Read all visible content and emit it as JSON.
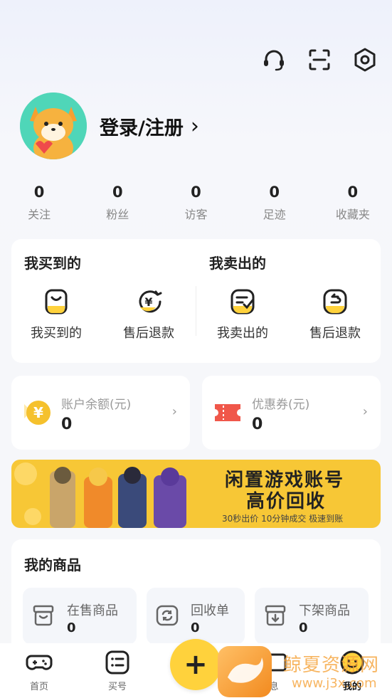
{
  "header": {
    "icons": [
      "headset-icon",
      "scan-icon",
      "settings-icon"
    ]
  },
  "profile": {
    "login_label": "登录/注册",
    "chevron": "›"
  },
  "stats": [
    {
      "value": "0",
      "label": "关注"
    },
    {
      "value": "0",
      "label": "粉丝"
    },
    {
      "value": "0",
      "label": "访客"
    },
    {
      "value": "0",
      "label": "足迹"
    },
    {
      "value": "0",
      "label": "收藏夹"
    }
  ],
  "orders": {
    "bought_title": "我买到的",
    "sold_title": "我卖出的",
    "items": [
      {
        "label": "我买到的",
        "icon": "bag-icon"
      },
      {
        "label": "售后退款",
        "icon": "refund-icon"
      },
      {
        "label": "我卖出的",
        "icon": "sold-list-icon"
      },
      {
        "label": "售后退款",
        "icon": "return-icon"
      }
    ]
  },
  "wallet": {
    "balance": {
      "label": "账户余额(元)",
      "value": "0",
      "icon": "yuan-coin-icon",
      "arrow": "›"
    },
    "coupon": {
      "label": "优惠券(元)",
      "value": "0",
      "icon": "ticket-icon",
      "arrow": "›"
    }
  },
  "banner": {
    "line1": "闲置游戏账号",
    "line2": "高价回收",
    "line3": "30秒出价 10分钟成交 极速到账"
  },
  "goods": {
    "title": "我的商品",
    "items": [
      {
        "label": "在售商品",
        "value": "0",
        "icon": "shop-box-icon"
      },
      {
        "label": "回收单",
        "value": "0",
        "icon": "recycle-icon"
      },
      {
        "label": "下架商品",
        "value": "0",
        "icon": "offshelf-icon"
      }
    ]
  },
  "tabbar": {
    "items": [
      {
        "label": "首页",
        "icon": "gamepad-icon"
      },
      {
        "label": "买号",
        "icon": "list-icon"
      },
      {
        "label": "息",
        "icon": "message-icon"
      },
      {
        "label": "我的",
        "icon": "profile-face-icon"
      }
    ],
    "publish": "+"
  },
  "watermark": {
    "text": "鲸夏资源网",
    "url": "www.j3x.com"
  },
  "colors": {
    "accent": "#ffd23c",
    "banner": "#f7c736",
    "coin": "#f5c12d",
    "coupon": "#f0574a"
  }
}
